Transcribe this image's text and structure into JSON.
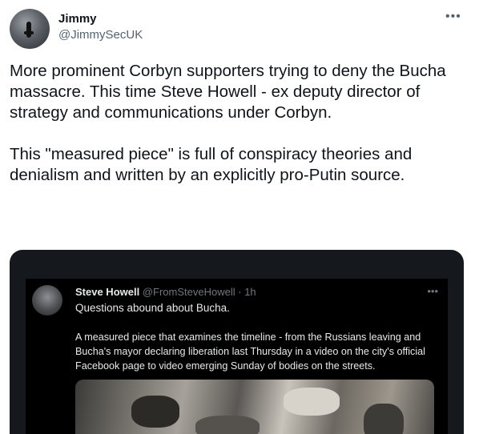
{
  "author": {
    "name": "Jimmy",
    "handle": "@JimmySecUK",
    "more_icon": "more-horizontal-icon"
  },
  "tweet": {
    "text": "More prominent Corbyn supporters trying to deny the Bucha massacre. This time Steve Howell - ex deputy director of strategy and communications under Corbyn.\n\nThis \"measured piece\" is full of conspiracy theories and denialism and written by an explicitly pro-Putin source."
  },
  "embedded": {
    "name": "Steve Howell",
    "handle": "@FromSteveHowell",
    "separator": "·",
    "time": "1h",
    "line1": "Questions abound about Bucha.",
    "body": "A measured piece that examines the timeline - from the Russians leaving and Bucha's mayor declaring liberation last Thursday in a video on the city's official Facebook page to video emerging Sunday of bodies on the streets."
  },
  "colors": {
    "text": "#0f1419",
    "secondary": "#536471",
    "dark_card": "#15181c",
    "dark_text": "#e7e9ea",
    "dark_secondary": "#71767b"
  }
}
